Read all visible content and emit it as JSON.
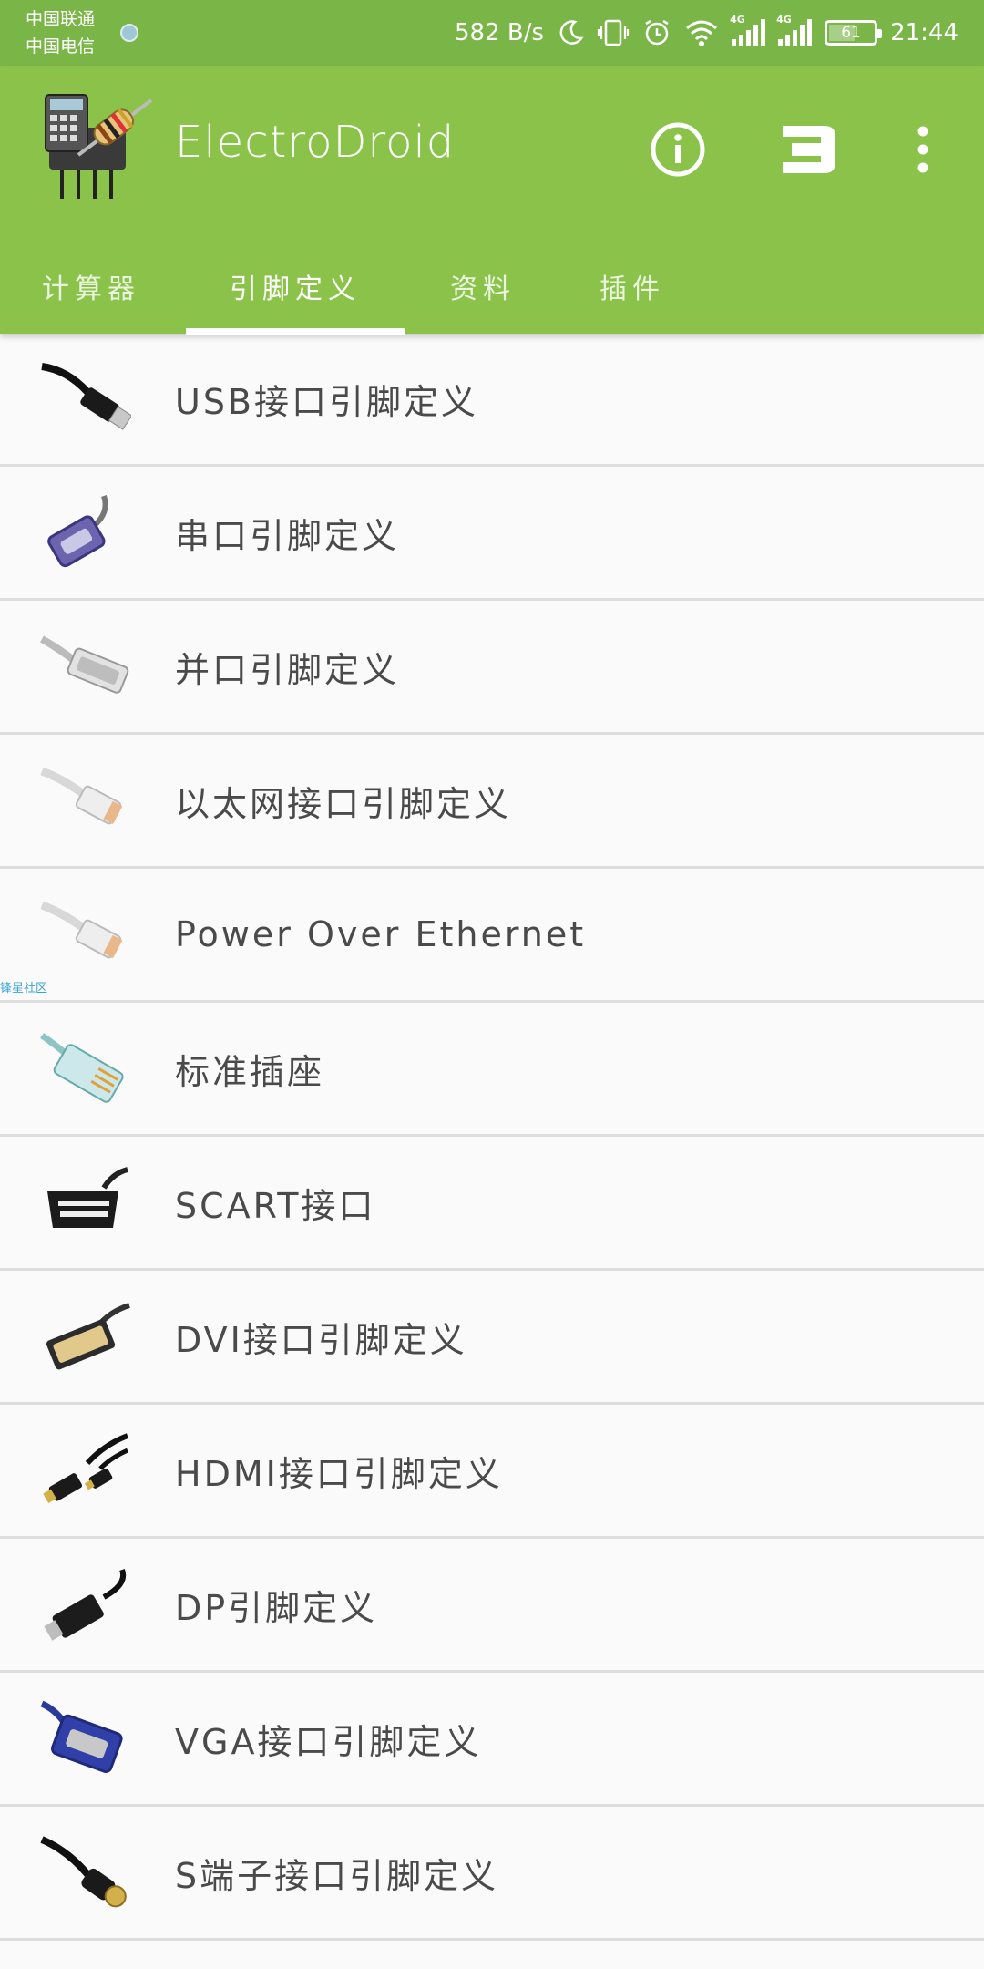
{
  "status_bar": {
    "carrier1": "中国联通",
    "carrier2": "中国电信",
    "speed": "582 B/s",
    "network1": "4G",
    "network2": "4G",
    "battery": "61",
    "battery_level": 0.61,
    "time": "21:44"
  },
  "app": {
    "title": "ElectroDroid",
    "accent": "#8bc34a"
  },
  "tabs": [
    {
      "label": "计算器",
      "active": false
    },
    {
      "label": "引脚定义",
      "active": true
    },
    {
      "label": "资料",
      "active": false
    },
    {
      "label": "插件",
      "active": false
    }
  ],
  "list": [
    {
      "label": "USB接口引脚定义",
      "icon": "usb-cable-icon"
    },
    {
      "label": "串口引脚定义",
      "icon": "serial-port-icon"
    },
    {
      "label": "并口引脚定义",
      "icon": "parallel-port-icon"
    },
    {
      "label": "以太网接口引脚定义",
      "icon": "ethernet-plug-icon"
    },
    {
      "label": "Power Over Ethernet",
      "icon": "poe-plug-icon"
    },
    {
      "label": "标准插座",
      "icon": "modular-plug-icon"
    },
    {
      "label": "SCART接口",
      "icon": "scart-plug-icon"
    },
    {
      "label": "DVI接口引脚定义",
      "icon": "dvi-plug-icon"
    },
    {
      "label": "HDMI接口引脚定义",
      "icon": "hdmi-cable-icon"
    },
    {
      "label": "DP引脚定义",
      "icon": "displayport-plug-icon"
    },
    {
      "label": "VGA接口引脚定义",
      "icon": "vga-plug-icon"
    },
    {
      "label": "S端子接口引脚定义",
      "icon": "s-video-plug-icon"
    }
  ],
  "watermark": "锋星社区"
}
